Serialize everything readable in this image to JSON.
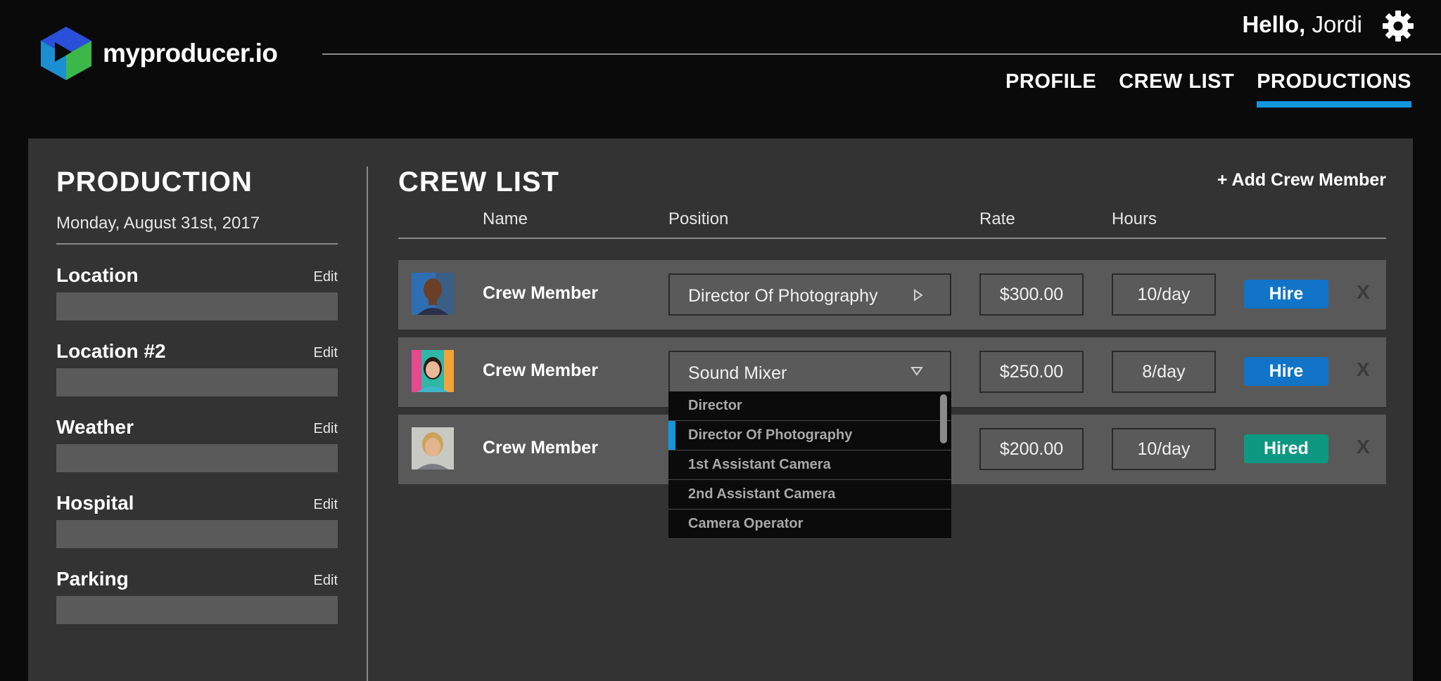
{
  "app": {
    "logo_text": "myproducer.io",
    "greeting_bold": "Hello,",
    "greeting_name": "Jordi"
  },
  "nav": {
    "items": [
      {
        "label": "PROFILE",
        "active": false
      },
      {
        "label": "CREW LIST",
        "active": false
      },
      {
        "label": "PRODUCTIONS",
        "active": true
      }
    ]
  },
  "colors": {
    "accent": "#1296e0",
    "hire": "#1174c8",
    "hired": "#0d9882",
    "panel": "#333333",
    "background": "#0a0a0a"
  },
  "sidebar": {
    "title": "PRODUCTION",
    "date": "Monday, August 31st, 2017",
    "fields": [
      {
        "label": "Location",
        "edit": "Edit",
        "value": ""
      },
      {
        "label": "Location #2",
        "edit": "Edit",
        "value": ""
      },
      {
        "label": "Weather",
        "edit": "Edit",
        "value": ""
      },
      {
        "label": "Hospital",
        "edit": "Edit",
        "value": ""
      },
      {
        "label": "Parking",
        "edit": "Edit",
        "value": ""
      }
    ]
  },
  "crew": {
    "title": "CREW LIST",
    "add_label": "+ Add Crew Member",
    "columns": {
      "name": "Name",
      "position": "Position",
      "rate": "Rate",
      "hours": "Hours"
    },
    "rows": [
      {
        "name": "Crew Member",
        "position": "Director Of Photography",
        "rate": "$300.00",
        "hours": "10/day",
        "action": "Hire",
        "status": "hire",
        "remove": "X",
        "dropdown_open": false
      },
      {
        "name": "Crew Member",
        "position": "Sound Mixer",
        "rate": "$250.00",
        "hours": "8/day",
        "action": "Hire",
        "status": "hire",
        "remove": "X",
        "dropdown_open": true
      },
      {
        "name": "Crew Member",
        "position": "",
        "rate": "$200.00",
        "hours": "10/day",
        "action": "Hired",
        "status": "hired",
        "remove": "X",
        "dropdown_open": false
      }
    ],
    "dropdown_options": [
      {
        "label": "Director",
        "active": false
      },
      {
        "label": "Director Of Photography",
        "active": true
      },
      {
        "label": "1st Assistant Camera",
        "active": false
      },
      {
        "label": "2nd Assistant Camera",
        "active": false
      },
      {
        "label": "Camera Operator",
        "active": false
      }
    ]
  }
}
